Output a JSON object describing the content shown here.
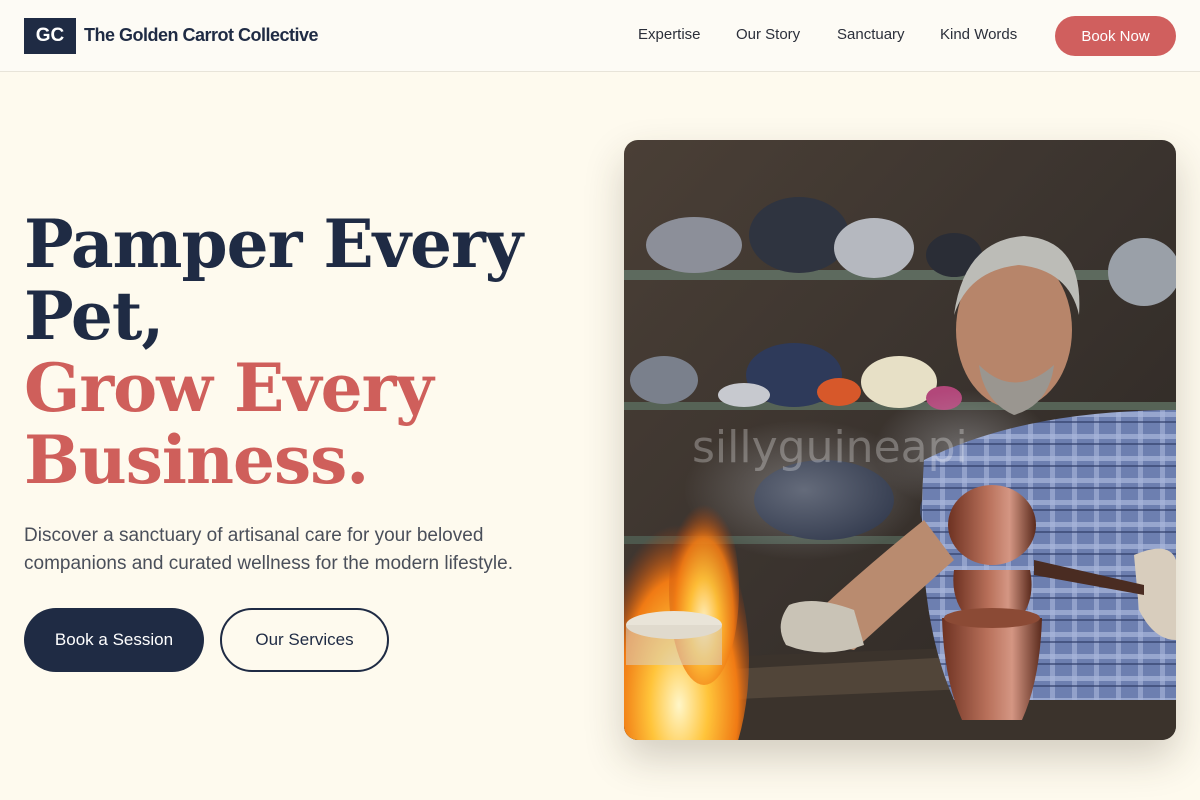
{
  "header": {
    "logo_initials": "GC",
    "brand_name": "The Golden Carrot Collective",
    "nav": [
      "Expertise",
      "Our Story",
      "Sanctuary",
      "Kind Words"
    ],
    "cta_label": "Book Now"
  },
  "hero": {
    "headline_line1": "Pamper Every",
    "headline_line2": "Pet,",
    "headline_line3": "Grow Every",
    "headline_line4": "Business.",
    "subtitle": "Discover a sanctuary of artisanal care for your beloved companions and curated wellness for the modern lifestyle.",
    "primary_button": "Book a Session",
    "secondary_button": "Our Services",
    "image_watermark": "sillyguineapi"
  },
  "colors": {
    "navy": "#1f2b44",
    "coral": "#d05f5e",
    "background": "#fefaee"
  }
}
